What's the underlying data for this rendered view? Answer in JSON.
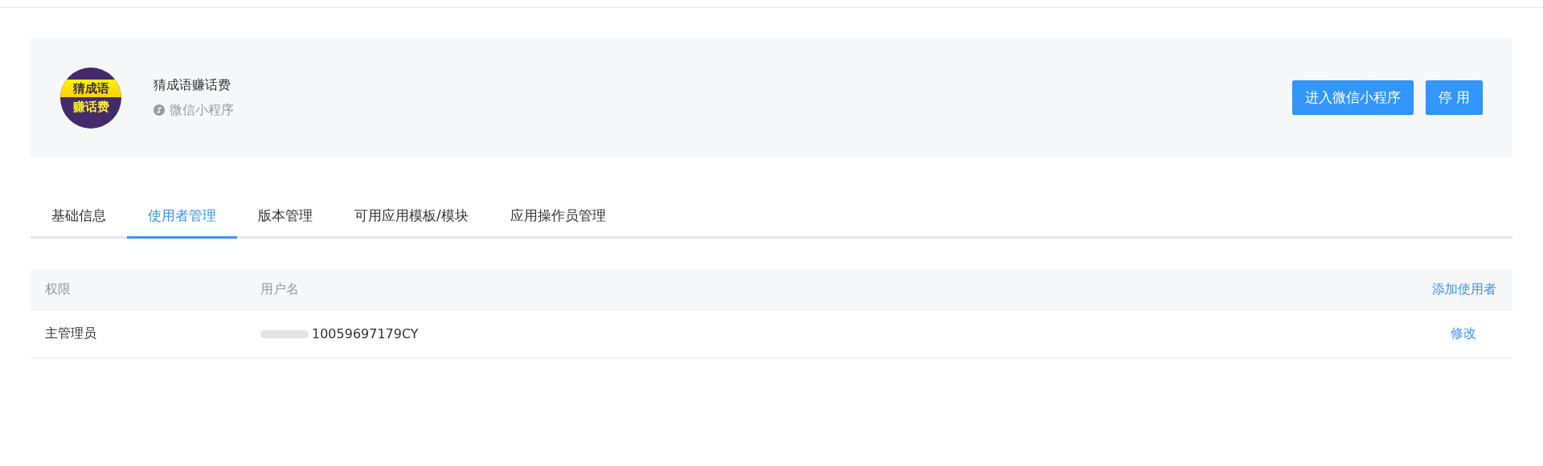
{
  "app": {
    "logo_lines": [
      "猜成语",
      "赚话费"
    ],
    "name": "猜成语赚话费",
    "type": "微信小程序"
  },
  "buttons": [
    {
      "label": "进入微信小程序"
    },
    {
      "label": "停 用"
    }
  ],
  "tabs": [
    {
      "label": "基础信息",
      "selected": false
    },
    {
      "label": "使用者管理",
      "selected": true
    },
    {
      "label": "版本管理",
      "selected": false
    },
    {
      "label": "可用应用模板/模块",
      "selected": false
    },
    {
      "label": "应用操作员管理",
      "selected": false
    }
  ],
  "table": {
    "columns": [
      "权限",
      "用户名"
    ],
    "header_action": "添加使用者",
    "rows": [
      {
        "role": "主管理员",
        "username": "10059697179CY",
        "redacted": true,
        "action": "修改"
      }
    ]
  }
}
